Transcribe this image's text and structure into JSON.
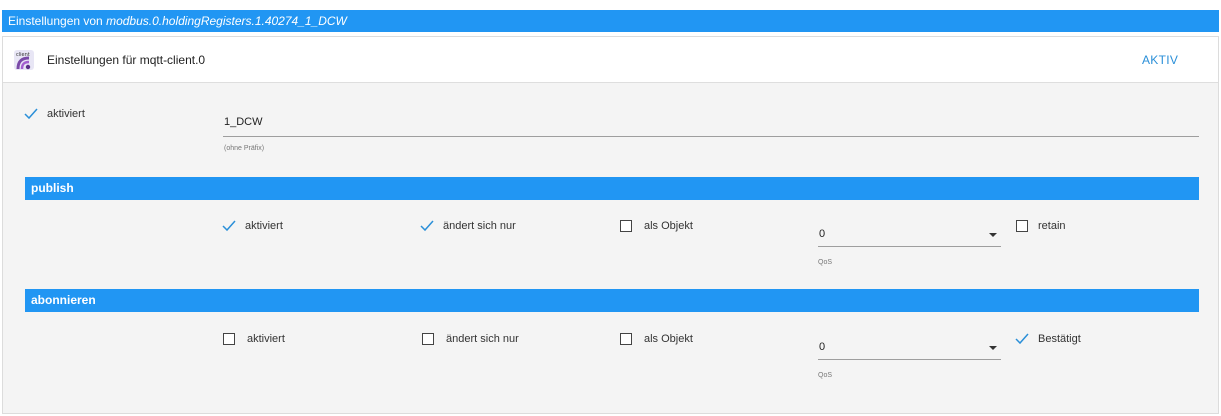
{
  "dialog": {
    "title_prefix": "Einstellungen von",
    "object_id": "modbus.0.holdingRegisters.1.40274_1_DCW"
  },
  "adapter": {
    "logo_text": "client",
    "title": "Einstellungen für mqtt-client.0",
    "state_label": "AKTIV"
  },
  "general": {
    "enabled_label": "aktiviert",
    "enabled": true,
    "topic_value": "1_DCW",
    "topic_helper": "(ohne Präfix)"
  },
  "publish": {
    "section_title": "publish",
    "enabled_label": "aktiviert",
    "enabled": true,
    "changes_only_label": "ändert sich nur",
    "changes_only": true,
    "as_object_label": "als Objekt",
    "as_object": false,
    "qos_value": "0",
    "qos_label": "QoS",
    "retain_label": "retain",
    "retain": false
  },
  "subscribe": {
    "section_title": "abonnieren",
    "enabled_label": "aktiviert",
    "enabled": false,
    "changes_only_label": "ändert sich nur",
    "changes_only": false,
    "as_object_label": "als Objekt",
    "as_object": false,
    "qos_value": "0",
    "qos_label": "QoS",
    "ack_label": "Bestätigt",
    "ack": true
  },
  "colors": {
    "accent": "#2196f3",
    "check": "#2a8fd8"
  }
}
